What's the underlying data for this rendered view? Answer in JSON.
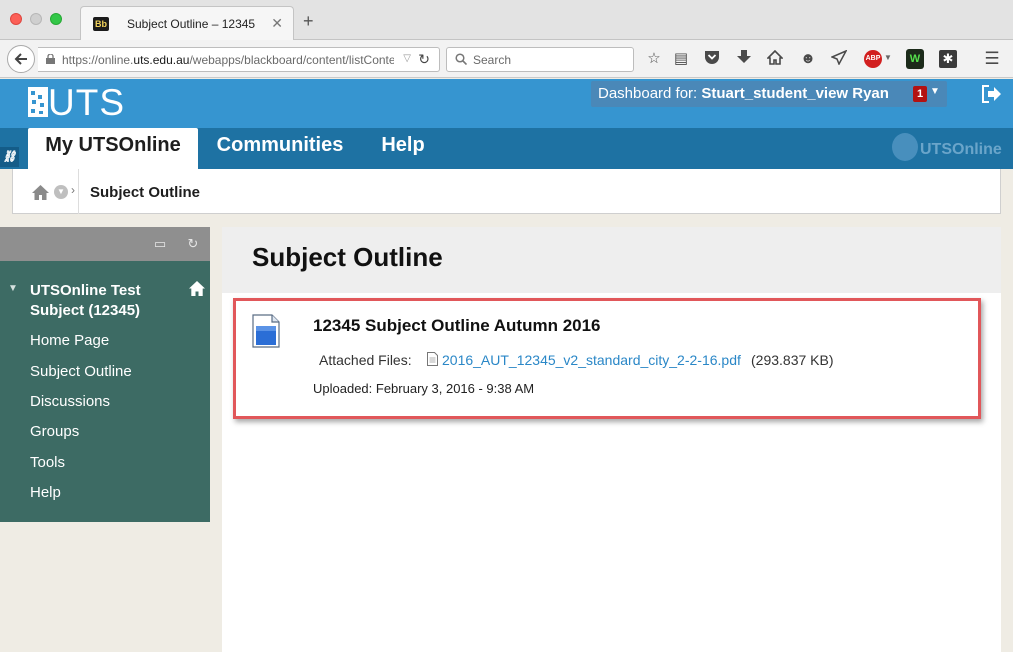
{
  "browser": {
    "tab_title": "Subject Outline – 12345",
    "tab_favicon": "Bb",
    "url_prefix": "https://online.",
    "url_domain": "uts.edu.au",
    "url_path": "/webapps/blackboard/content/listConte",
    "search_placeholder": "Search",
    "abp_label": "ABP",
    "ghostery_label": "W"
  },
  "header": {
    "logo_text": "UTS",
    "dashboard_label": "Dashboard for: ",
    "dashboard_user": "Stuart_student_view Ryan",
    "notification_count": "1",
    "tabs": [
      {
        "label": "My UTSOnline"
      },
      {
        "label": "Communities"
      },
      {
        "label": "Help"
      }
    ],
    "brand_mark": "UTSOnline"
  },
  "breadcrumb": {
    "current": "Subject Outline"
  },
  "course_menu": {
    "course_title": "UTSOnline Test Subject (12345)",
    "items": [
      {
        "label": "Home Page"
      },
      {
        "label": "Subject Outline"
      },
      {
        "label": "Discussions"
      },
      {
        "label": "Groups"
      },
      {
        "label": "Tools"
      },
      {
        "label": "Help"
      }
    ]
  },
  "content": {
    "page_title": "Subject Outline",
    "item": {
      "title": "12345 Subject Outline Autumn 2016",
      "attached_label": "Attached Files:",
      "file_name": "2016_AUT_12345_v2_standard_city_2-2-16.pdf",
      "file_size": "(293.837 KB)",
      "uploaded": "Uploaded: February 3, 2016 - 9:38 AM"
    }
  },
  "colors": {
    "uts_blue": "#3695d0",
    "tab_bar_blue": "#1e72a3",
    "sidebar_green": "#3d6b64",
    "highlight_red": "#e1575a",
    "link_blue": "#2a87c7"
  }
}
